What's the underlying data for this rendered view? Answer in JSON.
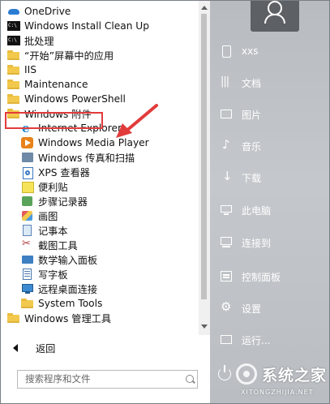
{
  "program_list": [
    {
      "label": "OneDrive",
      "icon": "onedrive-icon"
    },
    {
      "label": "Windows Install Clean Up",
      "icon": "installer-icon"
    },
    {
      "label": "批处理",
      "icon": "command-prompt-icon"
    },
    {
      "label": "“开始”屏幕中的应用",
      "icon": "folder-icon"
    },
    {
      "label": "IIS",
      "icon": "folder-icon"
    },
    {
      "label": "Maintenance",
      "icon": "folder-icon"
    },
    {
      "label": "Windows PowerShell",
      "icon": "folder-icon"
    },
    {
      "label": "Windows 附件",
      "icon": "folder-icon"
    },
    {
      "label": "Internet Explorer",
      "icon": "internet-explorer-icon"
    },
    {
      "label": "Windows Media Player",
      "icon": "media-player-icon"
    },
    {
      "label": "Windows 传真和扫描",
      "icon": "fax-scan-icon"
    },
    {
      "label": "XPS 查看器",
      "icon": "xps-viewer-icon"
    },
    {
      "label": "便利贴",
      "icon": "sticky-notes-icon"
    },
    {
      "label": "步骤记录器",
      "icon": "steps-recorder-icon"
    },
    {
      "label": "画图",
      "icon": "paint-icon"
    },
    {
      "label": "记事本",
      "icon": "notepad-icon"
    },
    {
      "label": "截图工具",
      "icon": "snipping-tool-icon"
    },
    {
      "label": "数学输入面板",
      "icon": "math-input-icon"
    },
    {
      "label": "写字板",
      "icon": "wordpad-icon"
    },
    {
      "label": "远程桌面连接",
      "icon": "remote-desktop-icon"
    },
    {
      "label": "System Tools",
      "icon": "folder-icon"
    },
    {
      "label": "Windows 管理工具",
      "icon": "folder-icon"
    }
  ],
  "back_label": "返回",
  "search": {
    "placeholder": "搜索程序和文件"
  },
  "user_menu": [
    {
      "label": "xxs",
      "icon": "user-folder-icon"
    },
    {
      "label": "文档",
      "icon": "documents-icon"
    },
    {
      "label": "图片",
      "icon": "pictures-icon"
    },
    {
      "label": "音乐",
      "icon": "music-icon"
    },
    {
      "label": "下载",
      "icon": "downloads-icon"
    },
    {
      "label": "此电脑",
      "icon": "this-pc-icon"
    },
    {
      "label": "连接到",
      "icon": "connect-to-icon"
    },
    {
      "label": "控制面板",
      "icon": "control-panel-icon"
    },
    {
      "label": "设置",
      "icon": "settings-icon"
    },
    {
      "label": "运行...",
      "icon": "run-icon"
    }
  ],
  "watermark": {
    "text": "系统之家",
    "sub": "XITONGZHIJIA.NET"
  },
  "colors": {
    "highlight": "#e23b3b",
    "right_pane": "#bfc3c7",
    "folder": "#f2c94c"
  }
}
